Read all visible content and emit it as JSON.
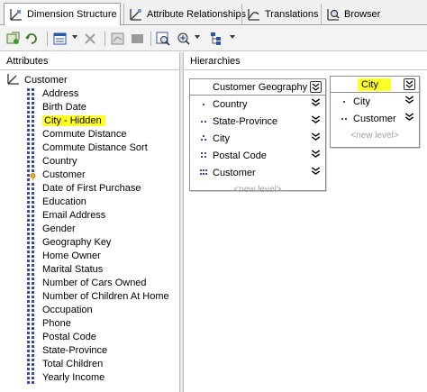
{
  "tabs": [
    {
      "label": "Dimension Structure",
      "icon": "dimension-structure-icon",
      "active": true
    },
    {
      "label": "Attribute Relationships",
      "icon": "attribute-relationships-icon",
      "active": false
    },
    {
      "label": "Translations",
      "icon": "translations-icon",
      "active": false
    },
    {
      "label": "Browser",
      "icon": "browser-icon",
      "active": false
    }
  ],
  "toolbar": {
    "icons": [
      "process-icon",
      "refresh-icon",
      "show-data-icon",
      "delete-icon",
      "diagram-icon",
      "hide-icon",
      "zoom-icon",
      "fit-icon",
      "layout-icon"
    ]
  },
  "attributes_pane": {
    "header": "Attributes",
    "root": "Customer",
    "items": [
      {
        "label": "Address",
        "icon": "attribute-icon"
      },
      {
        "label": "Birth Date",
        "icon": "attribute-icon"
      },
      {
        "label": "City - Hidden",
        "icon": "attribute-icon",
        "highlighted": true
      },
      {
        "label": "Commute Distance",
        "icon": "attribute-icon"
      },
      {
        "label": "Commute Distance Sort",
        "icon": "attribute-icon"
      },
      {
        "label": "Country",
        "icon": "attribute-icon"
      },
      {
        "label": "Customer",
        "icon": "key-attribute-icon"
      },
      {
        "label": "Date of First Purchase",
        "icon": "attribute-icon"
      },
      {
        "label": "Education",
        "icon": "attribute-icon"
      },
      {
        "label": "Email Address",
        "icon": "attribute-icon"
      },
      {
        "label": "Gender",
        "icon": "attribute-icon"
      },
      {
        "label": "Geography Key",
        "icon": "attribute-icon"
      },
      {
        "label": "Home Owner",
        "icon": "attribute-icon"
      },
      {
        "label": "Marital Status",
        "icon": "attribute-icon"
      },
      {
        "label": "Number of Cars Owned",
        "icon": "attribute-icon"
      },
      {
        "label": "Number of Children At Home",
        "icon": "attribute-icon"
      },
      {
        "label": "Occupation",
        "icon": "attribute-icon"
      },
      {
        "label": "Phone",
        "icon": "attribute-icon"
      },
      {
        "label": "Postal Code",
        "icon": "attribute-icon"
      },
      {
        "label": "State-Province",
        "icon": "attribute-icon"
      },
      {
        "label": "Total Children",
        "icon": "attribute-icon"
      },
      {
        "label": "Yearly Income",
        "icon": "attribute-icon"
      }
    ]
  },
  "hierarchies_pane": {
    "header": "Hierarchies",
    "hierarchies": [
      {
        "title": "Customer Geography",
        "highlighted": false,
        "collapse_glyph": "¥",
        "levels": [
          {
            "label": "Country",
            "chevron": "»"
          },
          {
            "label": "State-Province",
            "chevron": "»"
          },
          {
            "label": "City",
            "chevron": "»"
          },
          {
            "label": "Postal Code",
            "chevron": "»"
          },
          {
            "label": "Customer",
            "chevron": "»"
          }
        ],
        "new_level": "<new level>"
      },
      {
        "title": "City",
        "highlighted": true,
        "collapse_glyph": "¥",
        "levels": [
          {
            "label": "City",
            "chevron": "»"
          },
          {
            "label": "Customer",
            "chevron": "»"
          }
        ],
        "new_level": "<new level>"
      }
    ]
  },
  "colors": {
    "highlight": "#ffff24",
    "attribute_icon": "#3b4aa8",
    "new_level_text": "#a0a0a0"
  }
}
